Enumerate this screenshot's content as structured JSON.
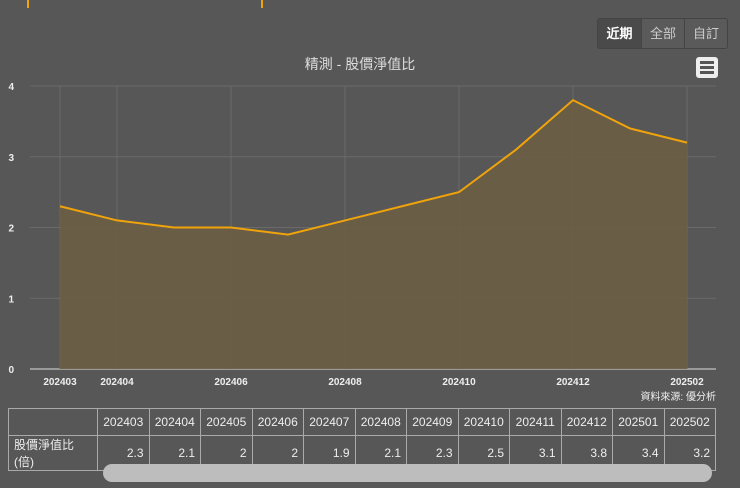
{
  "range_buttons": [
    "近期",
    "全部",
    "自訂"
  ],
  "menu_icon": "hamburger-menu-icon",
  "colors": {
    "line": "#f0a30a",
    "area": "#6b5e45"
  },
  "source": "資料來源: 優分析",
  "table": {
    "row_label": "股價淨值比(倍)"
  },
  "chart_data": {
    "type": "area",
    "title": "精測 - 股價淨值比",
    "categories": [
      "202403",
      "202404",
      "202405",
      "202406",
      "202407",
      "202408",
      "202409",
      "202410",
      "202411",
      "202412",
      "202501",
      "202502"
    ],
    "x_tick_labels": [
      "202403",
      "202404",
      "202406",
      "202408",
      "202410",
      "202412",
      "202502"
    ],
    "series": [
      {
        "name": "股價淨值比(倍)",
        "values": [
          2.3,
          2.1,
          2,
          2,
          1.9,
          2.1,
          2.3,
          2.5,
          3.1,
          3.8,
          3.4,
          3.2
        ]
      }
    ],
    "y_ticks": [
      0,
      1,
      2,
      3,
      4
    ],
    "ylim": [
      0,
      4
    ],
    "grid": true
  }
}
